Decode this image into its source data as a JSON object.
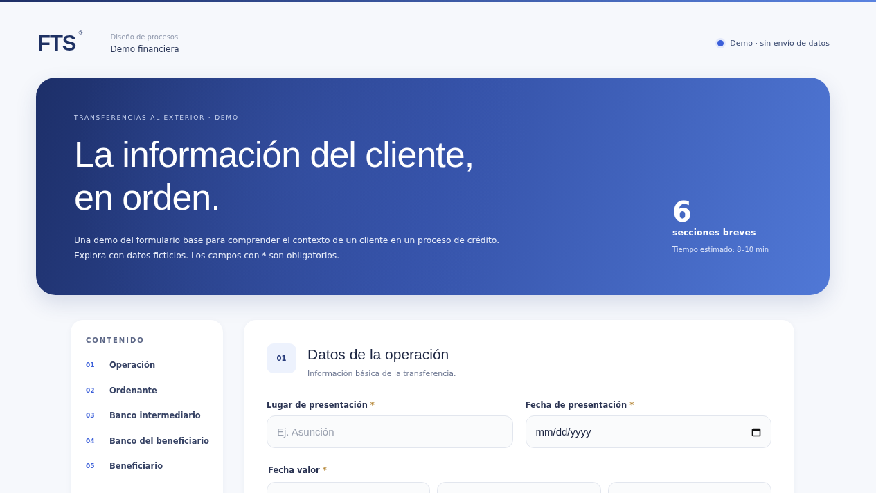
{
  "brand": {
    "logo": "FTS",
    "registered": "®",
    "subtitle": "Diseño de procesos",
    "title": "Demo financiera"
  },
  "status": {
    "label": "Demo · sin envío de datos",
    "color": "#3b5fd9"
  },
  "hero": {
    "eyebrow": "TRANSFERENCIAS AL EXTERIOR · DEMO",
    "title_lines": [
      "La información del cliente,",
      "en orden."
    ],
    "description_lines": [
      "Una demo del formulario base para comprender el contexto de un cliente en un proceso de crédito.",
      "Explora con datos ficticios. Los campos con * son obligatorios."
    ],
    "stat": {
      "value": "6",
      "label": "secciones breves",
      "note": "Tiempo estimado: 8–10 min"
    }
  },
  "sidebar": {
    "heading": "CONTENIDO",
    "items": [
      {
        "number": "01",
        "label": "Operación"
      },
      {
        "number": "02",
        "label": "Ordenante"
      },
      {
        "number": "03",
        "label": "Banco intermediario"
      },
      {
        "number": "04",
        "label": "Banco del beneficiario"
      },
      {
        "number": "05",
        "label": "Beneficiario"
      }
    ]
  },
  "section": {
    "number": "01",
    "title": "Datos de la operación",
    "subtitle": "Información básica de la transferencia.",
    "fields": [
      {
        "kind": "text",
        "label": "Lugar de presentación",
        "mark": "*",
        "placeholder": "Ej. Asunción"
      },
      {
        "kind": "date",
        "label": "Fecha de presentación",
        "mark": "*",
        "value": "mm/dd/yyyy"
      }
    ],
    "group": {
      "label": "Fecha valor",
      "mark": "*",
      "boxes": [
        {
          "kind": "input"
        },
        {
          "kind": "input"
        },
        {
          "kind": "input"
        }
      ]
    }
  }
}
